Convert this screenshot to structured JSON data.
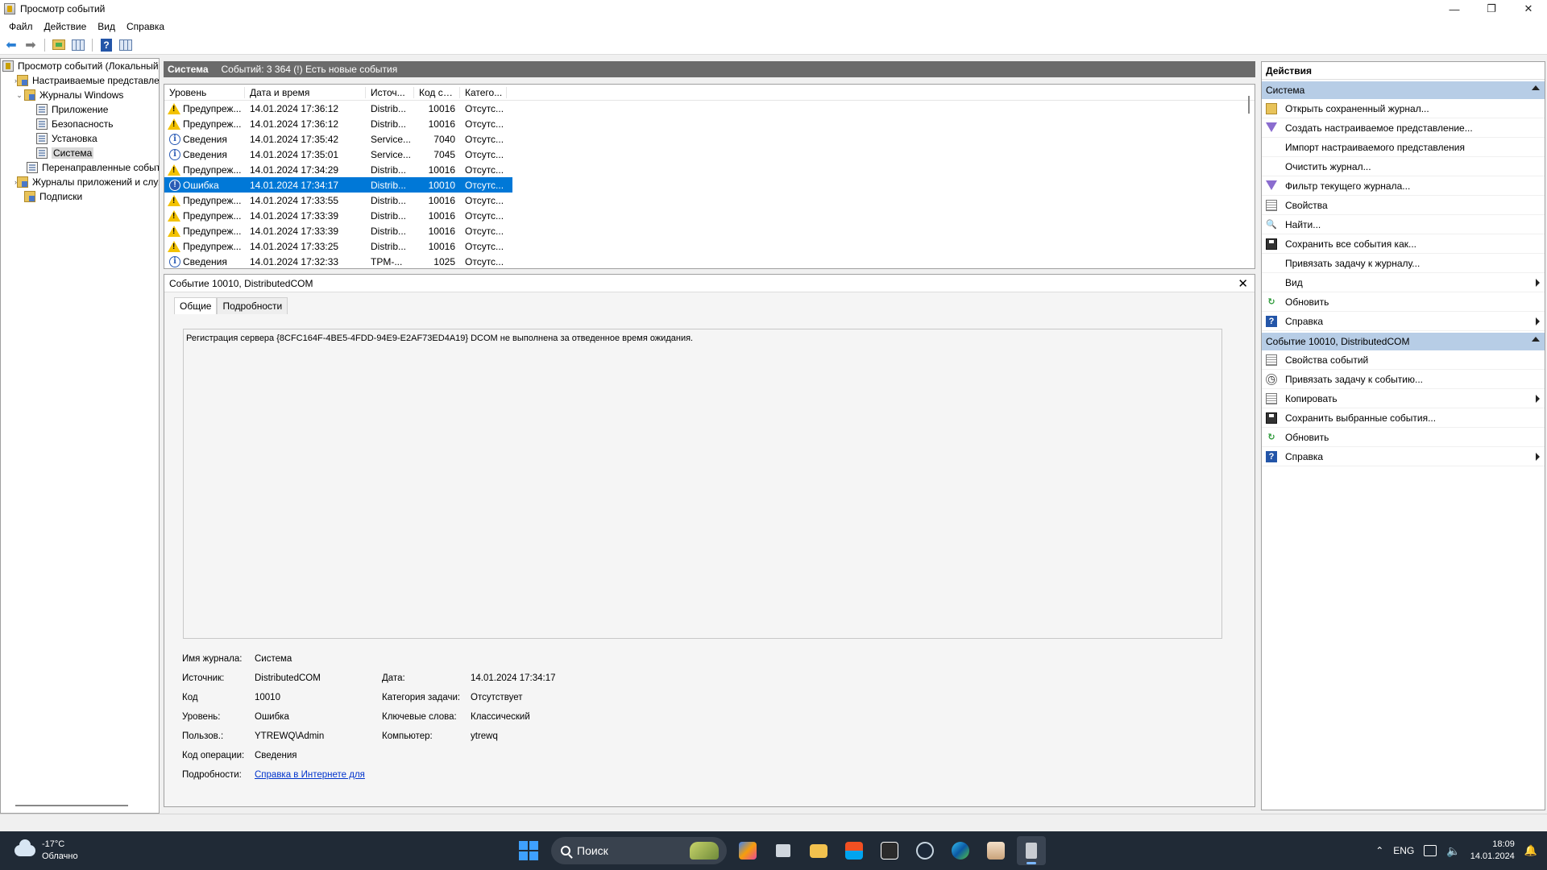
{
  "window": {
    "title": "Просмотр событий",
    "controls": [
      "—",
      "❐",
      "✕"
    ]
  },
  "menu": [
    "Файл",
    "Действие",
    "Вид",
    "Справка"
  ],
  "tree": [
    {
      "label": "Просмотр событий (Локальный)",
      "indent": 0,
      "icon": "event-viewer-icon",
      "expander": ""
    },
    {
      "label": "Настраиваемые представления",
      "indent": 1,
      "icon": "folder-icon",
      "expander": "›"
    },
    {
      "label": "Журналы Windows",
      "indent": 1,
      "icon": "folder-icon",
      "expander": "⌄"
    },
    {
      "label": "Приложение",
      "indent": 2,
      "icon": "log-icon",
      "expander": ""
    },
    {
      "label": "Безопасность",
      "indent": 2,
      "icon": "log-icon",
      "expander": ""
    },
    {
      "label": "Установка",
      "indent": 2,
      "icon": "log-icon",
      "expander": ""
    },
    {
      "label": "Система",
      "indent": 2,
      "icon": "log-icon",
      "expander": "",
      "selected": true
    },
    {
      "label": "Перенаправленные события",
      "indent": 2,
      "icon": "log-icon",
      "expander": ""
    },
    {
      "label": "Журналы приложений и служб",
      "indent": 1,
      "icon": "folder-icon",
      "expander": "›"
    },
    {
      "label": "Подписки",
      "indent": 1,
      "icon": "folder-icon",
      "expander": ""
    }
  ],
  "list_header": {
    "name": "Система",
    "summary": "Событий: 3 364 (!) Есть новые события"
  },
  "columns": [
    "Уровень",
    "Дата и время",
    "Источ...",
    "Код со...",
    "Катего..."
  ],
  "events": [
    {
      "level": "Предупреж...",
      "type": "warning",
      "date": "14.01.2024 17:36:12",
      "source": "Distrib...",
      "code": "10016",
      "category": "Отсутс..."
    },
    {
      "level": "Предупреж...",
      "type": "warning",
      "date": "14.01.2024 17:36:12",
      "source": "Distrib...",
      "code": "10016",
      "category": "Отсутс..."
    },
    {
      "level": "Сведения",
      "type": "info",
      "date": "14.01.2024 17:35:42",
      "source": "Service...",
      "code": "7040",
      "category": "Отсутс..."
    },
    {
      "level": "Сведения",
      "type": "info",
      "date": "14.01.2024 17:35:01",
      "source": "Service...",
      "code": "7045",
      "category": "Отсутс..."
    },
    {
      "level": "Предупреж...",
      "type": "warning",
      "date": "14.01.2024 17:34:29",
      "source": "Distrib...",
      "code": "10016",
      "category": "Отсутс..."
    },
    {
      "level": "Ошибка",
      "type": "error",
      "date": "14.01.2024 17:34:17",
      "source": "Distrib...",
      "code": "10010",
      "category": "Отсутс...",
      "selected": true
    },
    {
      "level": "Предупреж...",
      "type": "warning",
      "date": "14.01.2024 17:33:55",
      "source": "Distrib...",
      "code": "10016",
      "category": "Отсутс..."
    },
    {
      "level": "Предупреж...",
      "type": "warning",
      "date": "14.01.2024 17:33:39",
      "source": "Distrib...",
      "code": "10016",
      "category": "Отсутс..."
    },
    {
      "level": "Предупреж...",
      "type": "warning",
      "date": "14.01.2024 17:33:39",
      "source": "Distrib...",
      "code": "10016",
      "category": "Отсутс..."
    },
    {
      "level": "Предупреж...",
      "type": "warning",
      "date": "14.01.2024 17:33:25",
      "source": "Distrib...",
      "code": "10016",
      "category": "Отсутс..."
    },
    {
      "level": "Сведения",
      "type": "info",
      "date": "14.01.2024 17:32:33",
      "source": "TPM-...",
      "code": "1025",
      "category": "Отсутс..."
    }
  ],
  "detail": {
    "title": "Событие 10010, DistributedCOM",
    "close": "✕",
    "tabs": [
      "Общие",
      "Подробности"
    ],
    "message": "Регистрация сервера {8CFC164F-4BE5-4FDD-94E9-E2AF73ED4A19} DCOM не выполнена за отведенное время ожидания.",
    "fields": {
      "log_name_label": "Имя журнала:",
      "log_name": "Система",
      "source_label": "Источник:",
      "source": "DistributedCOM",
      "date_label": "Дата:",
      "date": "14.01.2024 17:34:17",
      "code_label": "Код",
      "code": "10010",
      "task_label": "Категория задачи:",
      "task": "Отсутствует",
      "level_label": "Уровень:",
      "level": "Ошибка",
      "keywords_label": "Ключевые слова:",
      "keywords": "Классический",
      "user_label": "Пользов.:",
      "user": "YTREWQ\\Admin",
      "computer_label": "Компьютер:",
      "computer": "ytrewq",
      "opcode_label": "Код операции:",
      "opcode": "Сведения",
      "more_label": "Подробности:",
      "more_link": "Справка в Интернете для "
    }
  },
  "actions": {
    "header": "Действия",
    "section1": "Система",
    "items1": [
      {
        "label": "Открыть сохраненный журнал...",
        "icon": "open-folder-icon"
      },
      {
        "label": "Создать настраиваемое представление...",
        "icon": "filter-icon"
      },
      {
        "label": "Импорт настраиваемого представления",
        "icon": ""
      },
      {
        "label": "Очистить журнал...",
        "icon": ""
      },
      {
        "label": "Фильтр текущего журнала...",
        "icon": "filter-icon"
      },
      {
        "label": "Свойства",
        "icon": "properties-icon"
      },
      {
        "label": "Найти...",
        "icon": "find-icon"
      },
      {
        "label": "Сохранить все события как...",
        "icon": "save-icon"
      },
      {
        "label": "Привязать задачу к журналу...",
        "icon": ""
      },
      {
        "label": "Вид",
        "icon": "",
        "submenu": true
      },
      {
        "label": "Обновить",
        "icon": "refresh-icon"
      },
      {
        "label": "Справка",
        "icon": "help-icon",
        "submenu": true
      }
    ],
    "section2": "Событие 10010, DistributedCOM",
    "items2": [
      {
        "label": "Свойства событий",
        "icon": "properties-icon"
      },
      {
        "label": "Привязать задачу к событию...",
        "icon": "task-icon"
      },
      {
        "label": "Копировать",
        "icon": "copy-icon",
        "submenu": true
      },
      {
        "label": "Сохранить выбранные события...",
        "icon": "save-icon"
      },
      {
        "label": "Обновить",
        "icon": "refresh-icon"
      },
      {
        "label": "Справка",
        "icon": "help-icon",
        "submenu": true
      }
    ]
  },
  "taskbar": {
    "temperature": "-17°C",
    "weather": "Облачно",
    "search_placeholder": "Поиск",
    "language": "ENG",
    "time": "18:09",
    "date": "14.01.2024"
  }
}
